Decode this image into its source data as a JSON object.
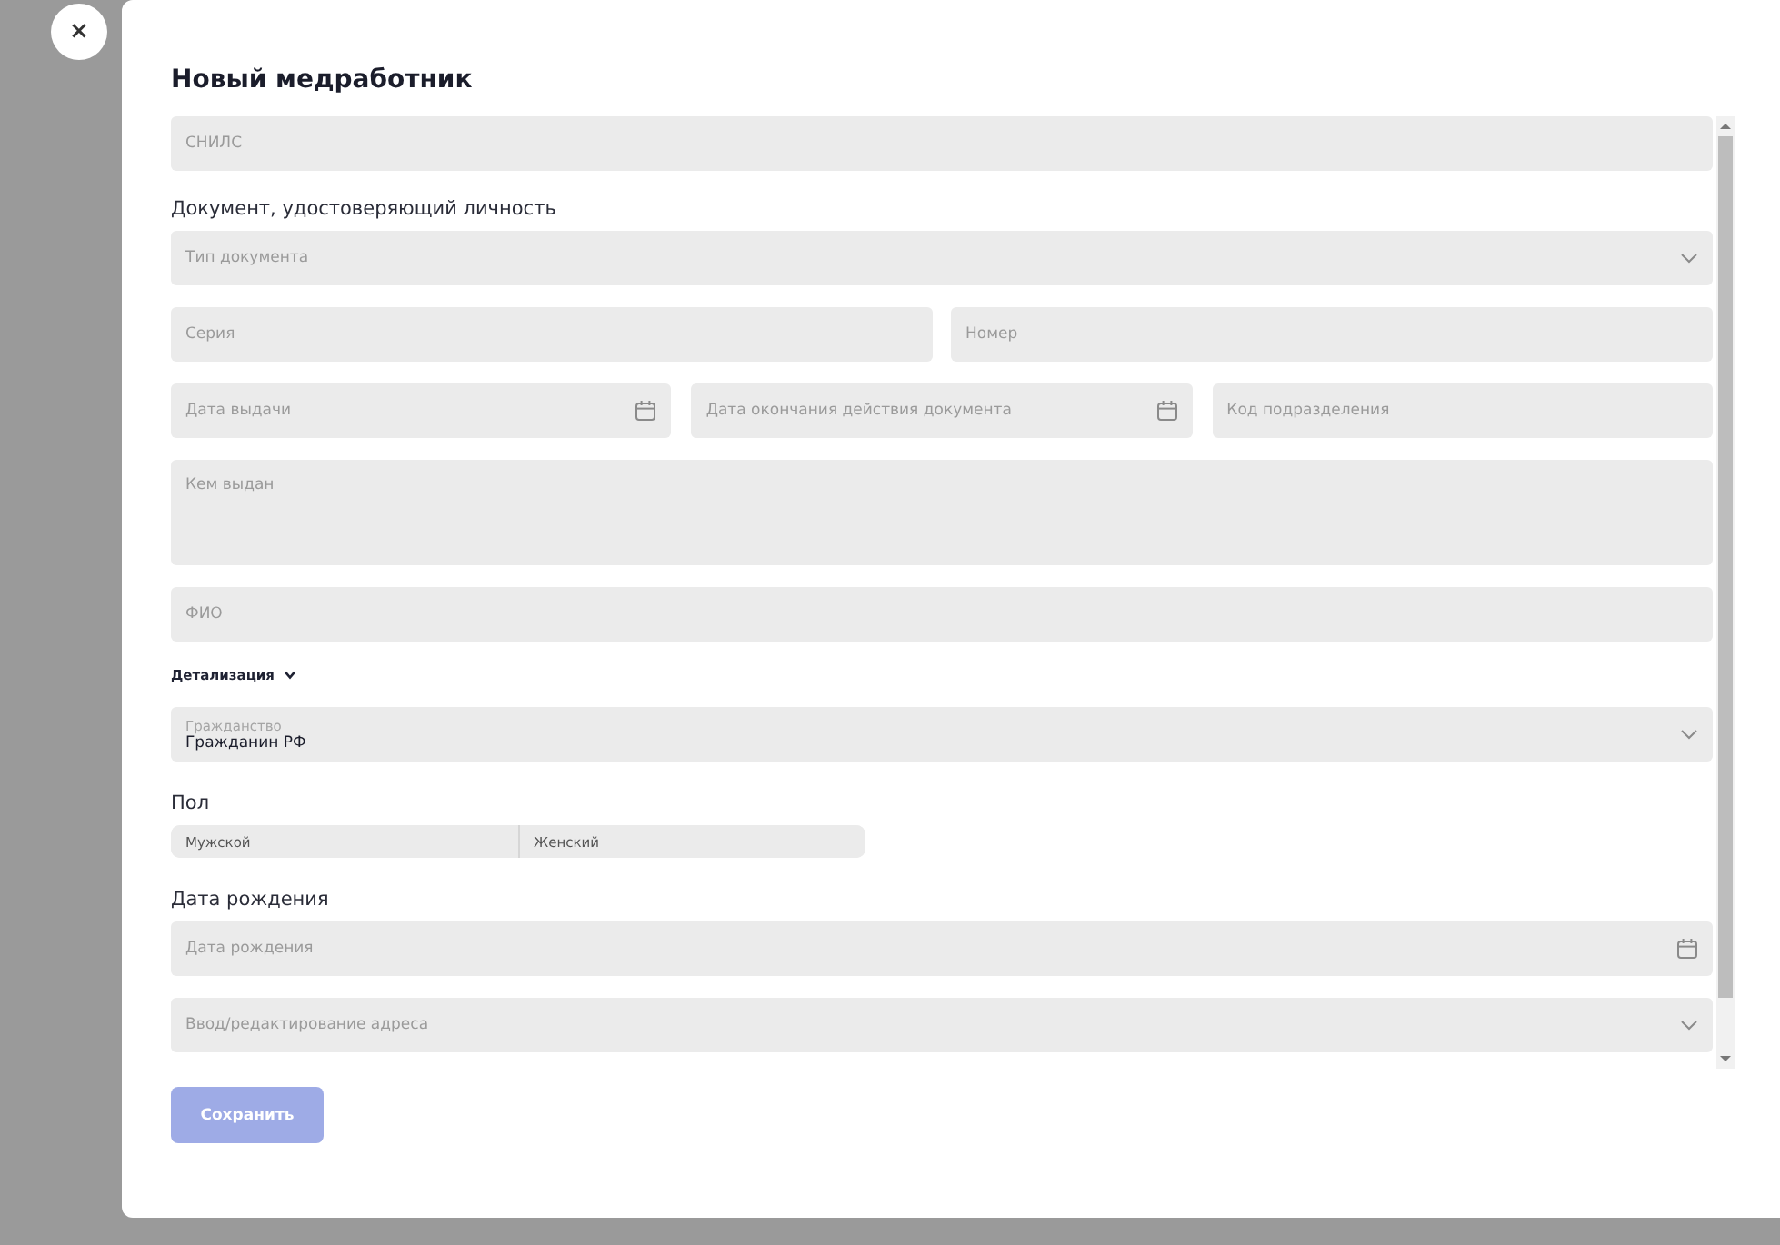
{
  "close_button": {
    "label": "×"
  },
  "title": "Новый медработник",
  "form": [
    {
      "kind": "row",
      "fields": [
        {
          "kind": "text",
          "placeholder": "СНИЛС"
        }
      ]
    },
    {
      "kind": "heading",
      "text": "Документ, удостоверяющий личность"
    },
    {
      "kind": "row",
      "fields": [
        {
          "kind": "select",
          "placeholder": "Тип документа"
        }
      ]
    },
    {
      "kind": "row",
      "fields": [
        {
          "kind": "text",
          "placeholder": "Серия"
        },
        {
          "kind": "text",
          "placeholder": "Номер"
        }
      ]
    },
    {
      "kind": "row",
      "fields": [
        {
          "kind": "date",
          "placeholder": "Дата выдачи"
        },
        {
          "kind": "date",
          "placeholder": "Дата окончания действия документа"
        },
        {
          "kind": "text",
          "placeholder": "Код подразделения"
        }
      ]
    },
    {
      "kind": "row",
      "fields": [
        {
          "kind": "textarea",
          "placeholder": "Кем выдан"
        }
      ]
    },
    {
      "kind": "row",
      "fields": [
        {
          "kind": "text",
          "placeholder": "ФИО"
        }
      ]
    },
    {
      "kind": "toggle",
      "text": "Детализация",
      "expanded": false
    },
    {
      "kind": "row",
      "fields": [
        {
          "kind": "select",
          "label": "Гражданство",
          "value": "Гражданин РФ"
        }
      ]
    },
    {
      "kind": "heading",
      "text": "Пол"
    },
    {
      "kind": "segmented",
      "options": [
        {
          "label": "Мужской",
          "selected": false
        },
        {
          "label": "Женский",
          "selected": false
        }
      ]
    },
    {
      "kind": "heading",
      "text": "Дата рождения"
    },
    {
      "kind": "row",
      "fields": [
        {
          "kind": "date",
          "placeholder": "Дата рождения"
        }
      ]
    },
    {
      "kind": "row",
      "fields": [
        {
          "kind": "select",
          "placeholder": "Ввод/редактирование адреса"
        }
      ]
    }
  ],
  "save_button": {
    "label": "Сохранить",
    "disabled": true
  }
}
